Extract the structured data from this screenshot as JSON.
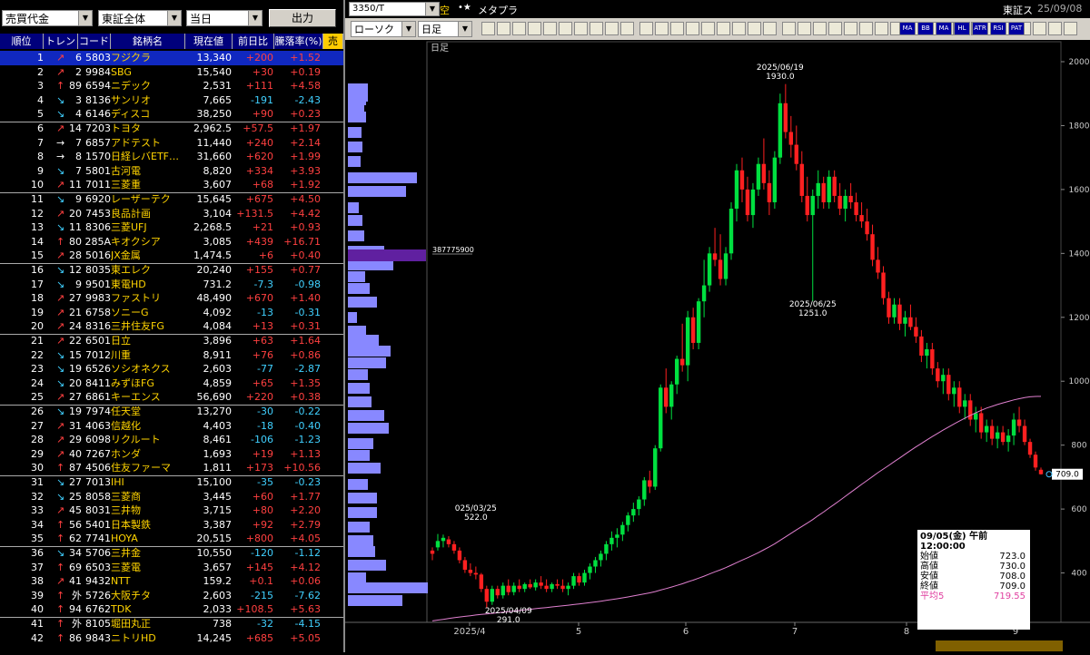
{
  "ranking_panel": {
    "sort_select": "売買代金",
    "market_select": "東証全体",
    "period_select": "当日",
    "output_button": "出力",
    "headers": [
      "順位",
      "トレンド",
      "コード",
      "銘柄名",
      "現在値",
      "前日比",
      "騰落率(%)",
      "売買"
    ],
    "rows": [
      {
        "rank": "1",
        "trend": "↗",
        "tn": "6",
        "code": "5803",
        "name": "フジクラ",
        "price": "13,340",
        "chg": "+200",
        "pct": "+1.52"
      },
      {
        "rank": "2",
        "trend": "↗",
        "tn": "2",
        "code": "9984",
        "name": "SBG",
        "price": "15,540",
        "chg": "+30",
        "pct": "+0.19"
      },
      {
        "rank": "3",
        "trend": "↑",
        "tn": "89",
        "code": "6594",
        "name": "ニデック",
        "price": "2,531",
        "chg": "+111",
        "pct": "+4.58"
      },
      {
        "rank": "4",
        "trend": "↘",
        "tn": "3",
        "code": "8136",
        "name": "サンリオ",
        "price": "7,665",
        "chg": "-191",
        "pct": "-2.43"
      },
      {
        "rank": "5",
        "trend": "↘",
        "tn": "4",
        "code": "6146",
        "name": "ディスコ",
        "price": "38,250",
        "chg": "+90",
        "pct": "+0.23"
      },
      {
        "rank": "6",
        "trend": "↗",
        "tn": "14",
        "code": "7203",
        "name": "トヨタ",
        "price": "2,962.5",
        "chg": "+57.5",
        "pct": "+1.97"
      },
      {
        "rank": "7",
        "trend": "→",
        "tn": "7",
        "code": "6857",
        "name": "アドテスト",
        "price": "11,440",
        "chg": "+240",
        "pct": "+2.14"
      },
      {
        "rank": "8",
        "trend": "→",
        "tn": "8",
        "code": "1570",
        "name": "日経レバETF…",
        "price": "31,660",
        "chg": "+620",
        "pct": "+1.99"
      },
      {
        "rank": "9",
        "trend": "↘",
        "tn": "7",
        "code": "5801",
        "name": "古河電",
        "price": "8,820",
        "chg": "+334",
        "pct": "+3.93"
      },
      {
        "rank": "10",
        "trend": "↗",
        "tn": "11",
        "code": "7011",
        "name": "三菱重",
        "price": "3,607",
        "chg": "+68",
        "pct": "+1.92"
      },
      {
        "rank": "11",
        "trend": "↘",
        "tn": "9",
        "code": "6920",
        "name": "レーザーテク",
        "price": "15,645",
        "chg": "+675",
        "pct": "+4.50"
      },
      {
        "rank": "12",
        "trend": "↗",
        "tn": "20",
        "code": "7453",
        "name": "良品計画",
        "price": "3,104",
        "chg": "+131.5",
        "pct": "+4.42"
      },
      {
        "rank": "13",
        "trend": "↘",
        "tn": "11",
        "code": "8306",
        "name": "三菱UFJ",
        "price": "2,268.5",
        "chg": "+21",
        "pct": "+0.93"
      },
      {
        "rank": "14",
        "trend": "↑",
        "tn": "80",
        "code": "285A",
        "name": "キオクシア",
        "price": "3,085",
        "chg": "+439",
        "pct": "+16.71"
      },
      {
        "rank": "15",
        "trend": "↗",
        "tn": "28",
        "code": "5016",
        "name": "JX金属",
        "price": "1,474.5",
        "chg": "+6",
        "pct": "+0.40"
      },
      {
        "rank": "16",
        "trend": "↘",
        "tn": "12",
        "code": "8035",
        "name": "東エレク",
        "price": "20,240",
        "chg": "+155",
        "pct": "+0.77"
      },
      {
        "rank": "17",
        "trend": "↘",
        "tn": "9",
        "code": "9501",
        "name": "東電HD",
        "price": "731.2",
        "chg": "-7.3",
        "pct": "-0.98"
      },
      {
        "rank": "18",
        "trend": "↗",
        "tn": "27",
        "code": "9983",
        "name": "ファストリ",
        "price": "48,490",
        "chg": "+670",
        "pct": "+1.40"
      },
      {
        "rank": "19",
        "trend": "↗",
        "tn": "21",
        "code": "6758",
        "name": "ソニーG",
        "price": "4,092",
        "chg": "-13",
        "pct": "-0.31"
      },
      {
        "rank": "20",
        "trend": "↗",
        "tn": "24",
        "code": "8316",
        "name": "三井住友FG",
        "price": "4,084",
        "chg": "+13",
        "pct": "+0.31"
      },
      {
        "rank": "21",
        "trend": "↗",
        "tn": "22",
        "code": "6501",
        "name": "日立",
        "price": "3,896",
        "chg": "+63",
        "pct": "+1.64"
      },
      {
        "rank": "22",
        "trend": "↘",
        "tn": "15",
        "code": "7012",
        "name": "川重",
        "price": "8,911",
        "chg": "+76",
        "pct": "+0.86"
      },
      {
        "rank": "23",
        "trend": "↘",
        "tn": "19",
        "code": "6526",
        "name": "ソシオネクス",
        "price": "2,603",
        "chg": "-77",
        "pct": "-2.87"
      },
      {
        "rank": "24",
        "trend": "↘",
        "tn": "20",
        "code": "8411",
        "name": "みずほFG",
        "price": "4,859",
        "chg": "+65",
        "pct": "+1.35"
      },
      {
        "rank": "25",
        "trend": "↗",
        "tn": "27",
        "code": "6861",
        "name": "キーエンス",
        "price": "56,690",
        "chg": "+220",
        "pct": "+0.38"
      },
      {
        "rank": "26",
        "trend": "↘",
        "tn": "19",
        "code": "7974",
        "name": "任天堂",
        "price": "13,270",
        "chg": "-30",
        "pct": "-0.22"
      },
      {
        "rank": "27",
        "trend": "↗",
        "tn": "31",
        "code": "4063",
        "name": "信越化",
        "price": "4,403",
        "chg": "-18",
        "pct": "-0.40"
      },
      {
        "rank": "28",
        "trend": "↗",
        "tn": "29",
        "code": "6098",
        "name": "リクルート",
        "price": "8,461",
        "chg": "-106",
        "pct": "-1.23"
      },
      {
        "rank": "29",
        "trend": "↗",
        "tn": "40",
        "code": "7267",
        "name": "ホンダ",
        "price": "1,693",
        "chg": "+19",
        "pct": "+1.13"
      },
      {
        "rank": "30",
        "trend": "↑",
        "tn": "87",
        "code": "4506",
        "name": "住友ファーマ",
        "price": "1,811",
        "chg": "+173",
        "pct": "+10.56"
      },
      {
        "rank": "31",
        "trend": "↘",
        "tn": "27",
        "code": "7013",
        "name": "IHI",
        "price": "15,100",
        "chg": "-35",
        "pct": "-0.23"
      },
      {
        "rank": "32",
        "trend": "↘",
        "tn": "25",
        "code": "8058",
        "name": "三菱商",
        "price": "3,445",
        "chg": "+60",
        "pct": "+1.77"
      },
      {
        "rank": "33",
        "trend": "↗",
        "tn": "45",
        "code": "8031",
        "name": "三井物",
        "price": "3,715",
        "chg": "+80",
        "pct": "+2.20"
      },
      {
        "rank": "34",
        "trend": "↑",
        "tn": "56",
        "code": "5401",
        "name": "日本製鉄",
        "price": "3,387",
        "chg": "+92",
        "pct": "+2.79"
      },
      {
        "rank": "35",
        "trend": "↑",
        "tn": "62",
        "code": "7741",
        "name": "HOYA",
        "price": "20,515",
        "chg": "+800",
        "pct": "+4.05"
      },
      {
        "rank": "36",
        "trend": "↘",
        "tn": "34",
        "code": "5706",
        "name": "三井金",
        "price": "10,550",
        "chg": "-120",
        "pct": "-1.12"
      },
      {
        "rank": "37",
        "trend": "↑",
        "tn": "69",
        "code": "6503",
        "name": "三菱電",
        "price": "3,657",
        "chg": "+145",
        "pct": "+4.12"
      },
      {
        "rank": "38",
        "trend": "↗",
        "tn": "41",
        "code": "9432",
        "name": "NTT",
        "price": "159.2",
        "chg": "+0.1",
        "pct": "+0.06"
      },
      {
        "rank": "39",
        "trend": "↑",
        "tn": "外",
        "code": "5726",
        "name": "大阪チタ",
        "price": "2,603",
        "chg": "-215",
        "pct": "-7.62"
      },
      {
        "rank": "40",
        "trend": "↑",
        "tn": "94",
        "code": "6762",
        "name": "TDK",
        "price": "2,033",
        "chg": "+108.5",
        "pct": "+5.63"
      },
      {
        "rank": "41",
        "trend": "↑",
        "tn": "外",
        "code": "8105",
        "name": "堀田丸正",
        "price": "738",
        "chg": "-32",
        "pct": "-4.15"
      },
      {
        "rank": "42",
        "trend": "↑",
        "tn": "86",
        "code": "9843",
        "name": "ニトリHD",
        "price": "14,245",
        "chg": "+685",
        "pct": "+5.05"
      }
    ]
  },
  "chart_panel": {
    "symbol_input": "3350/T",
    "name_label": "メタプラ",
    "flag_label": "空",
    "exchange": "東証ス",
    "date": "25/09/08",
    "chart_type_select": "ローソク",
    "period_select": "日足",
    "toolbar_buttons": [
      "MA",
      "BB",
      "MA",
      "HL",
      "ATR",
      "RSI",
      "PAT"
    ],
    "chart_label": "日足",
    "volume_marker_label": "387775900",
    "info_box": {
      "date_line": "09/05(金) 午前 12:00:00",
      "rows": [
        {
          "label": "始値",
          "value": "723.0"
        },
        {
          "label": "高値",
          "value": "730.0"
        },
        {
          "label": "安値",
          "value": "708.0"
        },
        {
          "label": "終値",
          "value": "709.0"
        },
        {
          "label": "平均5",
          "value": "719.55"
        }
      ]
    },
    "annotations": [
      {
        "text_date": "2025/06/19",
        "text_val": "1930.0"
      },
      {
        "text_date": "2025/06/25",
        "text_val": "1251.0"
      },
      {
        "text_date": "025/03/25",
        "text_val": "522.0"
      },
      {
        "text_date": "2025/04/09",
        "text_val": "291.0"
      }
    ],
    "last_price_tag": "709.0",
    "colors": {
      "up": "#ff2020",
      "down": "#00e040",
      "ma": "#e080d0",
      "vol": "#8888ff",
      "vol_hl": "#6020a0"
    }
  },
  "chart_data": {
    "type": "candlestick",
    "title": "",
    "xlabel": "",
    "ylabel": "",
    "ylim": [
      200,
      2000
    ],
    "y_ticks": [
      200,
      400,
      600,
      800,
      1000,
      1200,
      1400,
      1600,
      1800,
      2000
    ],
    "x_ticks": [
      "2025/4",
      "5",
      "6",
      "7",
      "8",
      "9"
    ],
    "ohlc_approx": [
      [
        470,
        480,
        440,
        460
      ],
      [
        480,
        522,
        470,
        500
      ],
      [
        500,
        520,
        480,
        510
      ],
      [
        505,
        515,
        480,
        490
      ],
      [
        490,
        500,
        460,
        470
      ],
      [
        470,
        480,
        430,
        440
      ],
      [
        440,
        450,
        400,
        410
      ],
      [
        410,
        430,
        390,
        400
      ],
      [
        400,
        420,
        380,
        395
      ],
      [
        395,
        400,
        340,
        350
      ],
      [
        350,
        360,
        291,
        310
      ],
      [
        310,
        360,
        300,
        350
      ],
      [
        350,
        360,
        320,
        330
      ],
      [
        330,
        370,
        320,
        360
      ],
      [
        360,
        380,
        330,
        340
      ],
      [
        340,
        370,
        330,
        360
      ],
      [
        360,
        380,
        340,
        350
      ],
      [
        350,
        370,
        340,
        365
      ],
      [
        365,
        380,
        350,
        355
      ],
      [
        355,
        380,
        345,
        370
      ],
      [
        370,
        390,
        350,
        360
      ],
      [
        360,
        380,
        340,
        350
      ],
      [
        350,
        370,
        340,
        365
      ],
      [
        365,
        380,
        350,
        360
      ],
      [
        360,
        380,
        340,
        350
      ],
      [
        350,
        370,
        330,
        360
      ],
      [
        360,
        400,
        350,
        390
      ],
      [
        390,
        400,
        360,
        370
      ],
      [
        370,
        410,
        360,
        400
      ],
      [
        400,
        430,
        380,
        420
      ],
      [
        420,
        450,
        400,
        440
      ],
      [
        440,
        470,
        420,
        460
      ],
      [
        460,
        500,
        440,
        490
      ],
      [
        490,
        530,
        470,
        510
      ],
      [
        510,
        540,
        480,
        520
      ],
      [
        520,
        560,
        500,
        550
      ],
      [
        550,
        590,
        530,
        580
      ],
      [
        580,
        620,
        560,
        600
      ],
      [
        600,
        640,
        580,
        630
      ],
      [
        630,
        700,
        610,
        690
      ],
      [
        690,
        720,
        650,
        670
      ],
      [
        670,
        800,
        660,
        790
      ],
      [
        790,
        990,
        780,
        980
      ],
      [
        980,
        1040,
        900,
        920
      ],
      [
        920,
        1000,
        880,
        990
      ],
      [
        990,
        1080,
        960,
        1070
      ],
      [
        1070,
        1180,
        1030,
        1050
      ],
      [
        1050,
        1220,
        1000,
        1200
      ],
      [
        1200,
        1230,
        1100,
        1120
      ],
      [
        1120,
        1260,
        1100,
        1250
      ],
      [
        1250,
        1380,
        1200,
        1300
      ],
      [
        1300,
        1420,
        1280,
        1400
      ],
      [
        1400,
        1480,
        1360,
        1380
      ],
      [
        1380,
        1460,
        1300,
        1320
      ],
      [
        1320,
        1420,
        1300,
        1400
      ],
      [
        1400,
        1560,
        1380,
        1540
      ],
      [
        1540,
        1680,
        1500,
        1660
      ],
      [
        1660,
        1700,
        1560,
        1600
      ],
      [
        1600,
        1640,
        1500,
        1520
      ],
      [
        1520,
        1620,
        1480,
        1600
      ],
      [
        1600,
        1700,
        1580,
        1680
      ],
      [
        1680,
        1760,
        1600,
        1620
      ],
      [
        1620,
        1660,
        1520,
        1560
      ],
      [
        1560,
        1720,
        1540,
        1700
      ],
      [
        1700,
        1900,
        1680,
        1870
      ],
      [
        1870,
        1930,
        1760,
        1780
      ],
      [
        1780,
        1830,
        1700,
        1740
      ],
      [
        1740,
        1800,
        1660,
        1680
      ],
      [
        1680,
        1720,
        1560,
        1580
      ],
      [
        1580,
        1640,
        1500,
        1520
      ],
      [
        1520,
        1600,
        1251,
        1580
      ],
      [
        1580,
        1660,
        1540,
        1620
      ],
      [
        1620,
        1640,
        1540,
        1560
      ],
      [
        1560,
        1660,
        1540,
        1640
      ],
      [
        1640,
        1660,
        1560,
        1580
      ],
      [
        1580,
        1620,
        1520,
        1540
      ],
      [
        1540,
        1600,
        1500,
        1580
      ],
      [
        1580,
        1620,
        1540,
        1560
      ],
      [
        1560,
        1590,
        1500,
        1520
      ],
      [
        1520,
        1560,
        1480,
        1500
      ],
      [
        1500,
        1540,
        1440,
        1460
      ],
      [
        1460,
        1490,
        1360,
        1380
      ],
      [
        1380,
        1420,
        1320,
        1340
      ],
      [
        1340,
        1360,
        1240,
        1260
      ],
      [
        1260,
        1280,
        1180,
        1200
      ],
      [
        1200,
        1260,
        1180,
        1240
      ],
      [
        1240,
        1260,
        1160,
        1180
      ],
      [
        1180,
        1220,
        1140,
        1200
      ],
      [
        1200,
        1240,
        1160,
        1170
      ],
      [
        1170,
        1200,
        1120,
        1140
      ],
      [
        1140,
        1160,
        1060,
        1080
      ],
      [
        1080,
        1120,
        1040,
        1100
      ],
      [
        1100,
        1120,
        1020,
        1040
      ],
      [
        1040,
        1060,
        980,
        1000
      ],
      [
        1000,
        1040,
        960,
        1020
      ],
      [
        1020,
        1040,
        940,
        960
      ],
      [
        960,
        1000,
        920,
        980
      ],
      [
        980,
        1000,
        900,
        920
      ],
      [
        920,
        960,
        880,
        940
      ],
      [
        940,
        960,
        860,
        880
      ],
      [
        880,
        920,
        840,
        900
      ],
      [
        900,
        920,
        820,
        840
      ],
      [
        840,
        880,
        810,
        860
      ],
      [
        860,
        880,
        800,
        820
      ],
      [
        820,
        860,
        790,
        840
      ],
      [
        840,
        860,
        800,
        810
      ],
      [
        810,
        850,
        780,
        830
      ],
      [
        830,
        900,
        800,
        880
      ],
      [
        880,
        920,
        840,
        860
      ],
      [
        860,
        880,
        800,
        810
      ],
      [
        810,
        820,
        760,
        770
      ],
      [
        770,
        780,
        720,
        730
      ],
      [
        723,
        730,
        708,
        709
      ]
    ]
  }
}
